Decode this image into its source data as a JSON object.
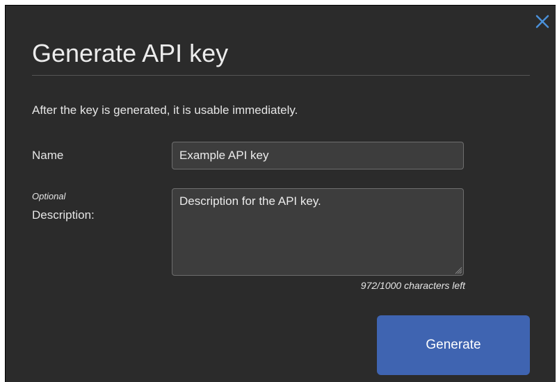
{
  "dialog": {
    "title": "Generate API key",
    "intro": "After the key is generated, it is usable immediately.",
    "close_icon": "close-icon"
  },
  "form": {
    "name_label": "Name",
    "name_value": "Example API key",
    "optional_label": "Optional",
    "description_label": "Description:",
    "description_value": "Description for the API key.",
    "counter": "972/1000 characters left"
  },
  "actions": {
    "generate_label": "Generate"
  },
  "colors": {
    "dialog_bg": "#2b2b2b",
    "input_bg": "#3d3d3d",
    "accent": "#3f64b1",
    "close_icon": "#4a90d9"
  }
}
